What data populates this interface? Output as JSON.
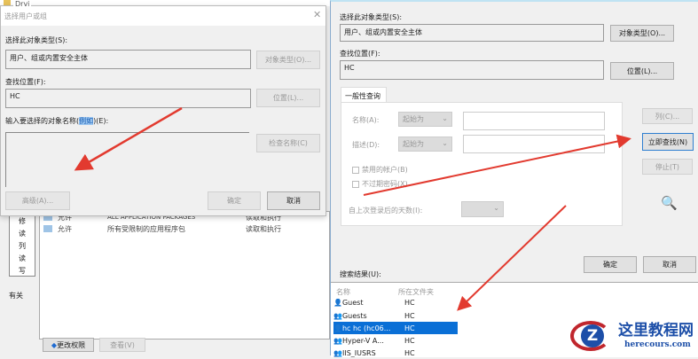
{
  "background": {
    "explorer_tab": "Drvi",
    "side_items": [
      "修",
      "读",
      "列",
      "读",
      "写"
    ],
    "side_note": "有关",
    "permissions": [
      {
        "type": "允许",
        "name": "ALL APPLICATION PACKAGES",
        "access": "读取和执行"
      },
      {
        "type": "允许",
        "name": "所有受限制的应用程序包",
        "access": "读取和执行"
      }
    ],
    "change_permissions": "更改权限",
    "view": "查看(V)"
  },
  "left_dialog": {
    "title": "选择用户或组",
    "object_type_label": "选择此对象类型(S):",
    "object_type_value": "用户、组或内置安全主体",
    "object_type_button": "对象类型(O)...",
    "location_label": "查找位置(F):",
    "location_value": "HC",
    "location_button": "位置(L)...",
    "names_label_prefix": "输入要选择的对象名称(",
    "names_label_link": "例如",
    "names_label_suffix": ")(E):",
    "check_names_button": "检查名称(C)",
    "advanced_button": "高级(A)...",
    "ok_button": "确定",
    "cancel_button": "取消"
  },
  "right_dialog": {
    "object_type_label": "选择此对象类型(S):",
    "object_type_value": "用户、组或内置安全主体",
    "object_type_button": "对象类型(O)...",
    "location_label": "查找位置(F):",
    "location_value": "HC",
    "location_button": "位置(L)...",
    "tab": "一般性查询",
    "name_label": "名称(A):",
    "name_mode": "起始为",
    "desc_label": "描述(D):",
    "desc_mode": "起始为",
    "disabled_accounts": "禁用的帐户(B)",
    "non_expiring": "不过期密码(X)",
    "days_label": "自上次登录后的天数(I):",
    "columns_button": "列(C)...",
    "find_now_button": "立即查找(N)",
    "stop_button": "停止(T)",
    "ok_button": "确定",
    "cancel_button": "取消",
    "results_label": "搜索结果(U):",
    "columns": [
      "名称",
      "所在文件夹"
    ],
    "results": [
      {
        "name": "Guest",
        "folder": "HC"
      },
      {
        "name": "Guests",
        "folder": "HC"
      },
      {
        "name": "hc hc (hc06...",
        "folder": "HC"
      },
      {
        "name": "Hyper-V A...",
        "folder": "HC"
      },
      {
        "name": "IIS_IUSRS",
        "folder": "HC"
      }
    ]
  },
  "watermark": {
    "title": "这里教程网",
    "url": "herecours.com"
  }
}
